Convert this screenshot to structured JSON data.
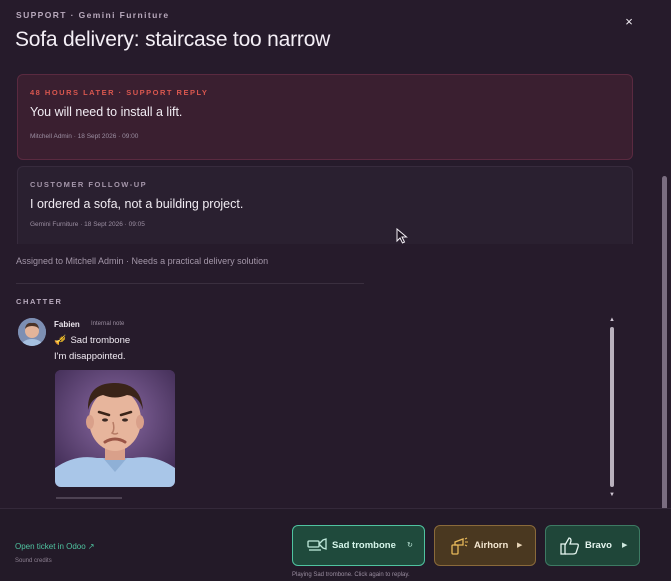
{
  "header": {
    "eyebrow": "SUPPORT · Gemini Furniture",
    "title": "Sofa delivery: staircase too narrow",
    "close_glyph": "×"
  },
  "thread": [
    {
      "label": "48 HOURS LATER · SUPPORT REPLY",
      "message": "You will need to install a lift.",
      "meta": "Mitchell Admin · 18 Sept 2026 · 09:00",
      "accent": "#d9574f"
    },
    {
      "label": "CUSTOMER FOLLOW-UP",
      "message": "I ordered a sofa, not a building project.",
      "meta": "Gemini Furniture · 18 Sept 2026 · 09:05"
    }
  ],
  "assignment": "Assigned to Mitchell Admin · Needs a practical delivery solution",
  "chatter": {
    "section_label": "CHATTER",
    "message": {
      "author": "Fabien",
      "note_tag": "Internal note",
      "sound_icon": "trumpet-icon",
      "sound_name": "Sad trombone",
      "text": "I'm disappointed.",
      "attachment": "disappointed-face-gif"
    }
  },
  "footer": {
    "open_link": "Open ticket in Odoo ↗",
    "credits": "Sound credits",
    "status": "Playing Sad trombone. Click again to replay.",
    "buttons": [
      {
        "label": "Sad trombone",
        "icon": "trombone-icon",
        "action_glyph": "↻",
        "state": "playing",
        "color": "#4fc3a0"
      },
      {
        "label": "Airhorn",
        "icon": "airhorn-icon",
        "action_glyph": "▶",
        "color": "#8a6a3a"
      },
      {
        "label": "Bravo",
        "icon": "thumbs-up-icon",
        "action_glyph": "▶",
        "color": "#3d7a63"
      }
    ]
  }
}
